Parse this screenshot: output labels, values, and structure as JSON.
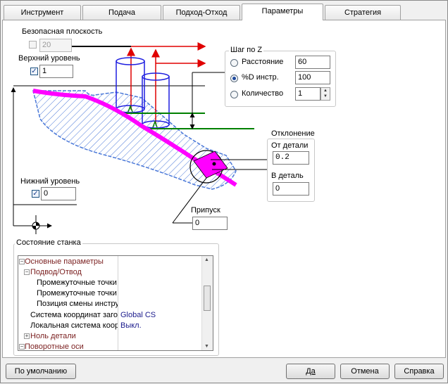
{
  "tabs": [
    "Инструмент",
    "Подача",
    "Подход-Отход",
    "Параметры",
    "Стратегия"
  ],
  "active_tab": "Параметры",
  "safe_plane": {
    "label": "Безопасная плоскость",
    "value": "20",
    "checked": false
  },
  "top_level": {
    "label": "Верхний уровень",
    "value": "1",
    "checked": true
  },
  "bottom_level": {
    "label": "Нижний уровень",
    "value": "0",
    "checked": true
  },
  "z_step": {
    "title": "Шаг по Z",
    "options": [
      {
        "label": "Расстояние",
        "value": "60",
        "selected": false
      },
      {
        "label": "%D инстр.",
        "value": "100",
        "selected": true
      },
      {
        "label": "Количество",
        "value": "1",
        "selected": false
      }
    ]
  },
  "deviation": {
    "title": "Отклонение",
    "from_part_label": "От детали",
    "from_part_value": "0.2",
    "into_part_label": "В деталь",
    "into_part_value": "0"
  },
  "allowance": {
    "label": "Припуск",
    "value": "0"
  },
  "machine_state": {
    "title": "Состояние станка",
    "rows": [
      {
        "name": "Основные параметры",
        "value": "",
        "toggle": "⊟",
        "style": "cat"
      },
      {
        "name": "Подвод/Отвод",
        "value": "",
        "toggle": "⊟",
        "style": "cat"
      },
      {
        "name": "Промежуточные точки",
        "value": "",
        "toggle": "",
        "style": "leaf"
      },
      {
        "name": "Промежуточные точки",
        "value": "",
        "toggle": "",
        "style": "leaf"
      },
      {
        "name": "Позиция смены инструмента",
        "value": "",
        "toggle": "",
        "style": "leaf"
      },
      {
        "name": "Система координат заготовки",
        "value": "Global CS",
        "toggle": "",
        "style": "leaf"
      },
      {
        "name": "Локальная система координат",
        "value": "Выкл.",
        "toggle": "",
        "style": "leaf"
      },
      {
        "name": "Ноль детали",
        "value": "",
        "toggle": "⊞",
        "style": "cat"
      },
      {
        "name": "Поворотные оси",
        "value": "",
        "toggle": "⊟",
        "style": "cat"
      }
    ]
  },
  "buttons": {
    "default": "По умолчанию",
    "ok": "Да",
    "cancel": "Отмена",
    "help": "Справка"
  },
  "colors": {
    "hatch": "#4a78d8",
    "path": "#ff00ff",
    "arrow": "#e00000",
    "level": "#008000",
    "tool": "#1d1de0"
  }
}
